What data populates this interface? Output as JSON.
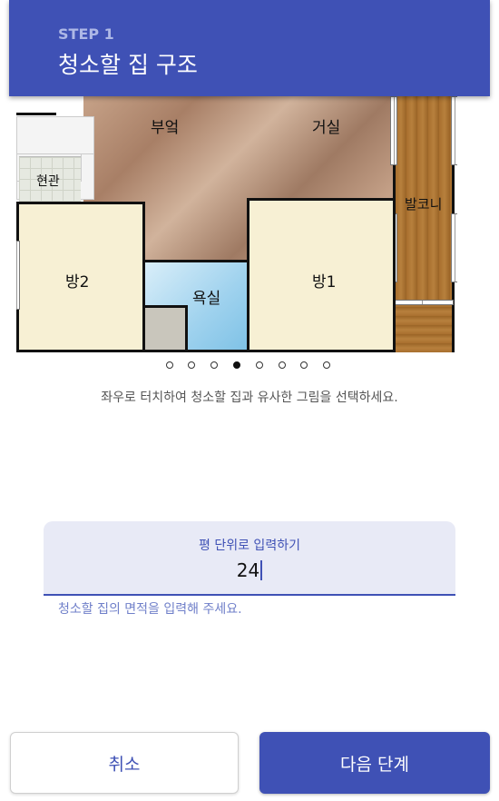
{
  "header": {
    "step": "STEP 1",
    "title": "청소할 집 구조"
  },
  "floorplan": {
    "rooms": {
      "kitchen": "부엌",
      "living": "거실",
      "entrance": "현관",
      "balcony": "발코니",
      "room2": "방2",
      "bath": "욕실",
      "room1": "방1"
    }
  },
  "carousel": {
    "total": 8,
    "active_index": 3
  },
  "hint": "좌우로 터치하여 청소할 집과 유사한 그림을 선택하세요.",
  "area_field": {
    "label": "평 단위로 입력하기",
    "value": "24",
    "helper": "청소할 집의 면적을 입력해 주세요."
  },
  "buttons": {
    "cancel": "취소",
    "next": "다음 단계"
  },
  "colors": {
    "primary": "#3f51b5",
    "field_bg": "#e8eaf6"
  }
}
